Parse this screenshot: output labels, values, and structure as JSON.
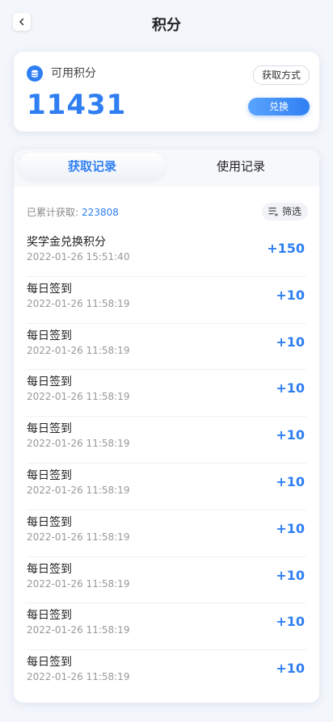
{
  "header": {
    "title": "积分"
  },
  "points": {
    "label": "可用积分",
    "value": "11431",
    "obtain_label": "获取方式",
    "exchange_label": "兑换"
  },
  "tabs": [
    {
      "label": "获取记录",
      "active": true
    },
    {
      "label": "使用记录",
      "active": false
    }
  ],
  "summary": {
    "label": "已累计获取:",
    "value": "223808",
    "filter_label": "筛选"
  },
  "records": [
    {
      "title": "奖学金兑换积分",
      "time": "2022-01-26 15:51:40",
      "amount": "+150"
    },
    {
      "title": "每日签到",
      "time": "2022-01-26 11:58:19",
      "amount": "+10"
    },
    {
      "title": "每日签到",
      "time": "2022-01-26 11:58:19",
      "amount": "+10"
    },
    {
      "title": "每日签到",
      "time": "2022-01-26 11:58:19",
      "amount": "+10"
    },
    {
      "title": "每日签到",
      "time": "2022-01-26 11:58:19",
      "amount": "+10"
    },
    {
      "title": "每日签到",
      "time": "2022-01-26 11:58:19",
      "amount": "+10"
    },
    {
      "title": "每日签到",
      "time": "2022-01-26 11:58:19",
      "amount": "+10"
    },
    {
      "title": "每日签到",
      "time": "2022-01-26 11:58:19",
      "amount": "+10"
    },
    {
      "title": "每日签到",
      "time": "2022-01-26 11:58:19",
      "amount": "+10"
    },
    {
      "title": "每日签到",
      "time": "2022-01-26 11:58:19",
      "amount": "+10"
    }
  ],
  "colors": {
    "accent": "#2f7ff2",
    "background": "#f3f6fb"
  },
  "icons": {
    "back": "chevron-left-icon",
    "coin": "coin-icon",
    "filter": "filter-icon"
  }
}
